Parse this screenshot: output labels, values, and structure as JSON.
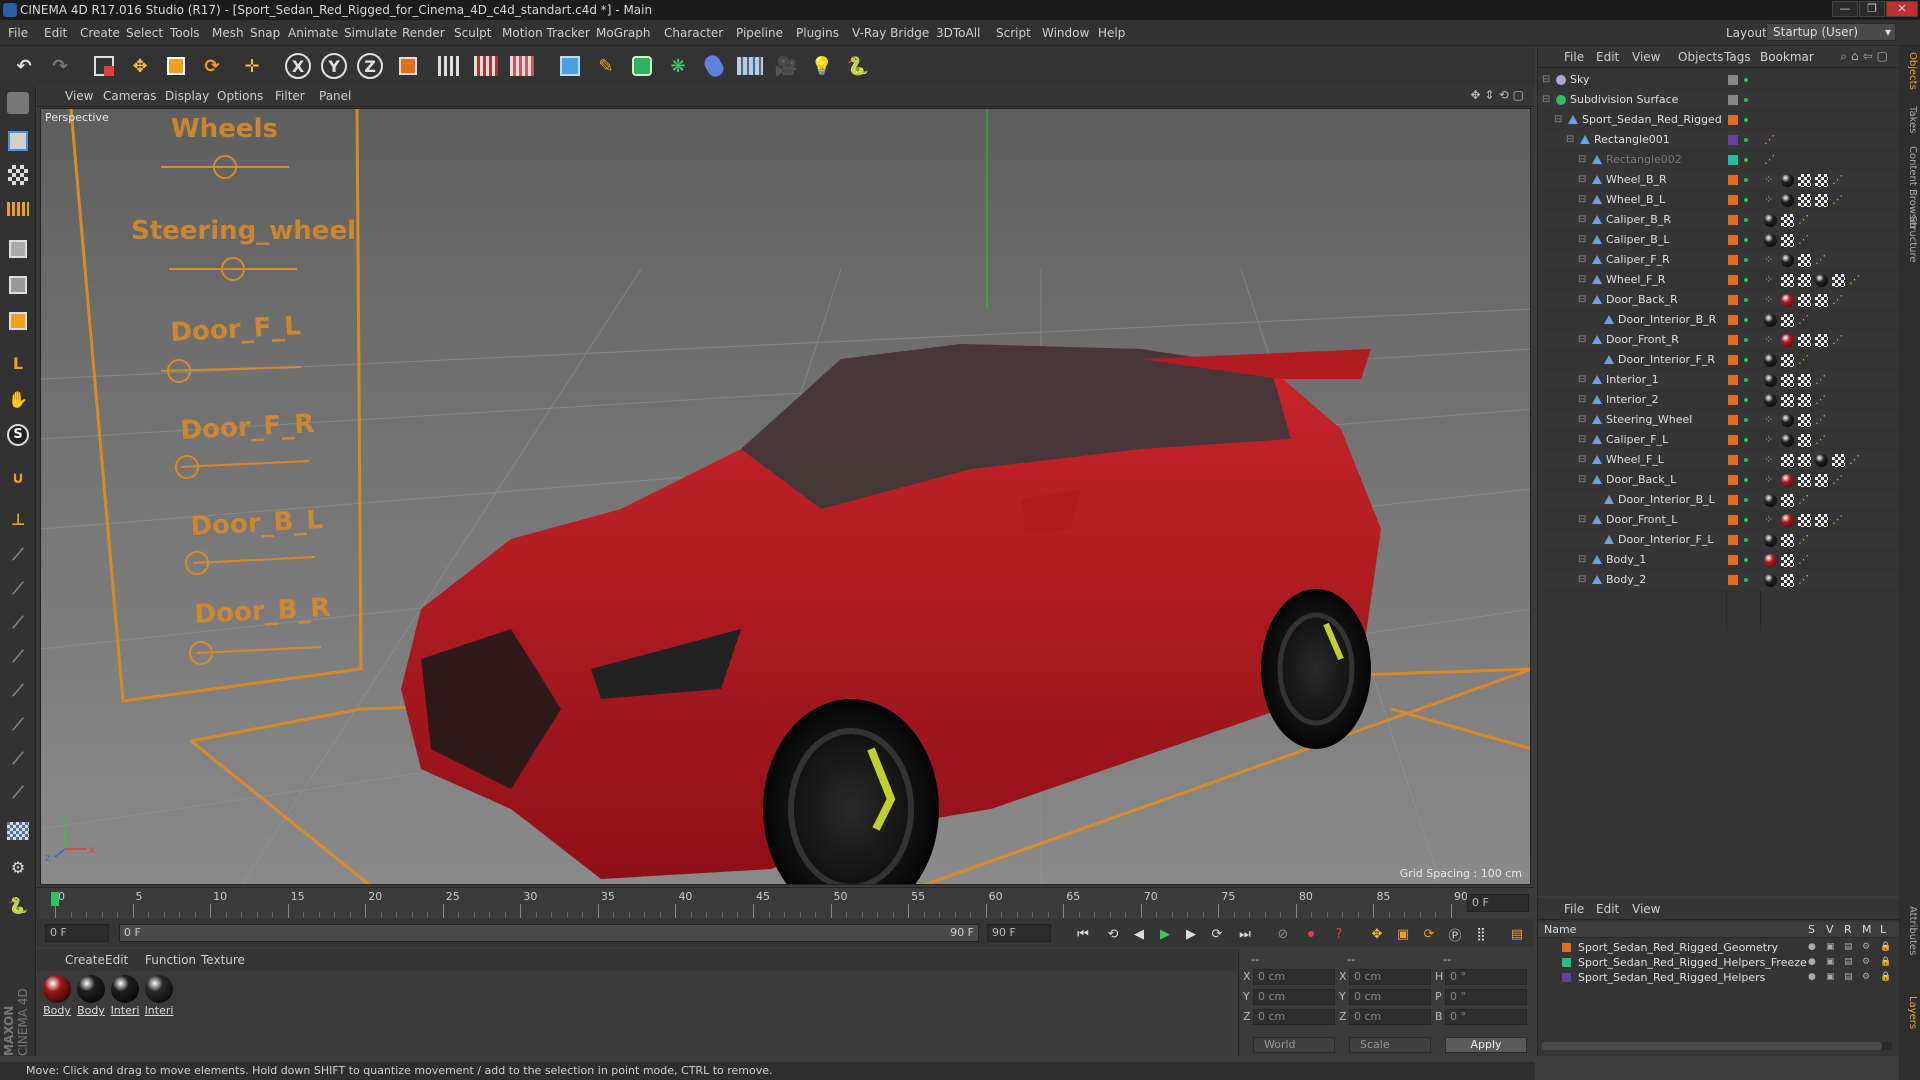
{
  "window": {
    "title": "CINEMA 4D R17.016 Studio (R17) - [Sport_Sedan_Red_Rigged_for_Cinema_4D_c4d_standart.c4d *] - Main"
  },
  "menubar": {
    "items": [
      "File",
      "Edit",
      "Create",
      "Select",
      "Tools",
      "Mesh",
      "Snap",
      "Animate",
      "Simulate",
      "Render",
      "Sculpt",
      "Motion Tracker",
      "MoGraph",
      "Character",
      "Pipeline",
      "Plugins",
      "V-Ray Bridge",
      "3DToAll",
      "Script",
      "Window",
      "Help"
    ],
    "layout_label": "Layout:",
    "layout_value": "Startup (User)"
  },
  "toolbar": {
    "axis_x": "X",
    "axis_y": "Y",
    "axis_z": "Z"
  },
  "viewport": {
    "menu": [
      "View",
      "Cameras",
      "Display",
      "Options",
      "Filter",
      "Panel"
    ],
    "label": "Perspective",
    "grid_spacing": "Grid Spacing : 100 cm",
    "rig_labels": [
      "Wheels",
      "Steering_wheel",
      "Door_F_L",
      "Door_F_R",
      "Door_B_L",
      "Door_B_R"
    ],
    "axis_y": "y",
    "axis_x": "x",
    "axis_z": "z"
  },
  "timeline": {
    "ticks": [
      "0",
      "5",
      "10",
      "15",
      "20",
      "25",
      "30",
      "35",
      "40",
      "45",
      "50",
      "55",
      "60",
      "65",
      "70",
      "75",
      "80",
      "85",
      "90"
    ],
    "current_frame_display": "0 F",
    "start_field": "0 F",
    "slider_left": "0 F",
    "slider_right": "90 F",
    "end_field": "90 F"
  },
  "materials": {
    "menu": [
      "Create",
      "Edit",
      "Function",
      "Texture"
    ],
    "items": [
      {
        "label": "Body",
        "color": "#a01818"
      },
      {
        "label": "Body",
        "color": "#1e1e1e"
      },
      {
        "label": "Interi",
        "color": "#1e1e1e"
      },
      {
        "label": "Interi",
        "color": "#2a2a2a"
      }
    ]
  },
  "coords": {
    "rows": [
      {
        "a": "X",
        "av": "0 cm",
        "b": "X",
        "bv": "0 cm",
        "c": "H",
        "cv": "0 °"
      },
      {
        "a": "Y",
        "av": "0 cm",
        "b": "Y",
        "bv": "0 cm",
        "c": "P",
        "cv": "0 °"
      },
      {
        "a": "Z",
        "av": "0 cm",
        "b": "Z",
        "bv": "0 cm",
        "c": "B",
        "cv": "0 °"
      }
    ],
    "header_left": "--",
    "header_mid": "--",
    "header_right": "--",
    "mode_world": "World",
    "mode_scale": "Scale",
    "apply": "Apply"
  },
  "status": {
    "text": "Move: Click and drag to move elements. Hold down SHIFT to quantize movement / add to the selection in point mode, CTRL to remove."
  },
  "objects": {
    "menu": [
      "File",
      "Edit",
      "View",
      "Objects",
      "Tags",
      "Bookmar"
    ],
    "rows": [
      {
        "name": "Sky",
        "indent": 0,
        "color": "#888888",
        "tags": []
      },
      {
        "name": "Subdivision Surface",
        "indent": 0,
        "color": "#888888",
        "tags": []
      },
      {
        "name": "Sport_Sedan_Red_Rigged",
        "indent": 1,
        "color": "#e07020",
        "tags": []
      },
      {
        "name": "Rectangle001",
        "indent": 2,
        "color": "#6040a0",
        "tags": [
          "x"
        ]
      },
      {
        "name": "Rectangle002",
        "indent": 3,
        "color": "#20c0a0",
        "tags": [
          "x"
        ],
        "dim": true
      },
      {
        "name": "Wheel_B_R",
        "indent": 3,
        "color": "#e07020",
        "tags": [
          "d",
          "b",
          "c",
          "c",
          "x"
        ]
      },
      {
        "name": "Wheel_B_L",
        "indent": 3,
        "color": "#e07020",
        "tags": [
          "d",
          "b",
          "c",
          "c",
          "x"
        ]
      },
      {
        "name": "Caliper_B_R",
        "indent": 3,
        "color": "#e07020",
        "tags": [
          "b",
          "c",
          "x"
        ]
      },
      {
        "name": "Caliper_B_L",
        "indent": 3,
        "color": "#e07020",
        "tags": [
          "b",
          "c",
          "x"
        ]
      },
      {
        "name": "Caliper_F_R",
        "indent": 3,
        "color": "#e07020",
        "tags": [
          "d",
          "b",
          "c",
          "x"
        ]
      },
      {
        "name": "Wheel_F_R",
        "indent": 3,
        "color": "#e07020",
        "tags": [
          "d",
          "c",
          "c",
          "b",
          "c",
          "x"
        ]
      },
      {
        "name": "Door_Back_R",
        "indent": 3,
        "color": "#e07020",
        "tags": [
          "d",
          "r",
          "c",
          "c",
          "x"
        ]
      },
      {
        "name": "Door_Interior_B_R",
        "indent": 4,
        "color": "#e07020",
        "tags": [
          "b",
          "c",
          "x"
        ]
      },
      {
        "name": "Door_Front_R",
        "indent": 3,
        "color": "#e07020",
        "tags": [
          "d",
          "r",
          "c",
          "c",
          "x"
        ]
      },
      {
        "name": "Door_Interior_F_R",
        "indent": 4,
        "color": "#e07020",
        "tags": [
          "b",
          "c",
          "x"
        ]
      },
      {
        "name": "Interior_1",
        "indent": 3,
        "color": "#e07020",
        "tags": [
          "b",
          "c",
          "c",
          "x"
        ]
      },
      {
        "name": "Interior_2",
        "indent": 3,
        "color": "#e07020",
        "tags": [
          "b",
          "c",
          "c",
          "x"
        ]
      },
      {
        "name": "Steering_Wheel",
        "indent": 3,
        "color": "#e07020",
        "tags": [
          "d",
          "b",
          "c",
          "x"
        ]
      },
      {
        "name": "Caliper_F_L",
        "indent": 3,
        "color": "#e07020",
        "tags": [
          "d",
          "b",
          "c",
          "x"
        ]
      },
      {
        "name": "Wheel_F_L",
        "indent": 3,
        "color": "#e07020",
        "tags": [
          "d",
          "c",
          "c",
          "b",
          "c",
          "x"
        ]
      },
      {
        "name": "Door_Back_L",
        "indent": 3,
        "color": "#e07020",
        "tags": [
          "d",
          "r",
          "c",
          "c",
          "x"
        ]
      },
      {
        "name": "Door_Interior_B_L",
        "indent": 4,
        "color": "#e07020",
        "tags": [
          "b",
          "c",
          "x"
        ]
      },
      {
        "name": "Door_Front_L",
        "indent": 3,
        "color": "#e07020",
        "tags": [
          "d",
          "r",
          "c",
          "c",
          "x"
        ]
      },
      {
        "name": "Door_Interior_F_L",
        "indent": 4,
        "color": "#e07020",
        "tags": [
          "b",
          "c",
          "x"
        ]
      },
      {
        "name": "Body_1",
        "indent": 3,
        "color": "#e07020",
        "tags": [
          "r",
          "c",
          "x"
        ]
      },
      {
        "name": "Body_2",
        "indent": 3,
        "color": "#e07020",
        "tags": [
          "b",
          "c",
          "x"
        ]
      }
    ]
  },
  "layers": {
    "menu": [
      "File",
      "Edit",
      "View"
    ],
    "header_name": "Name",
    "header_cols": [
      "S",
      "V",
      "R",
      "M",
      "L"
    ],
    "rows": [
      {
        "name": "Sport_Sedan_Red_Rigged_Geometry",
        "color": "#e07020"
      },
      {
        "name": "Sport_Sedan_Red_Rigged_Helpers_Freeze",
        "color": "#20c080"
      },
      {
        "name": "Sport_Sedan_Red_Rigged_Helpers",
        "color": "#6040a0"
      }
    ]
  },
  "side_tabs": [
    "Objects",
    "Takes",
    "Content Browser",
    "Structure",
    "Attributes",
    "Layers"
  ],
  "maxon": {
    "line1": "MAXON",
    "line2": "CINEMA 4D"
  },
  "colors": {
    "accent": "#4a8fd8",
    "car": "#b01c22",
    "rig": "#d88a2a"
  }
}
